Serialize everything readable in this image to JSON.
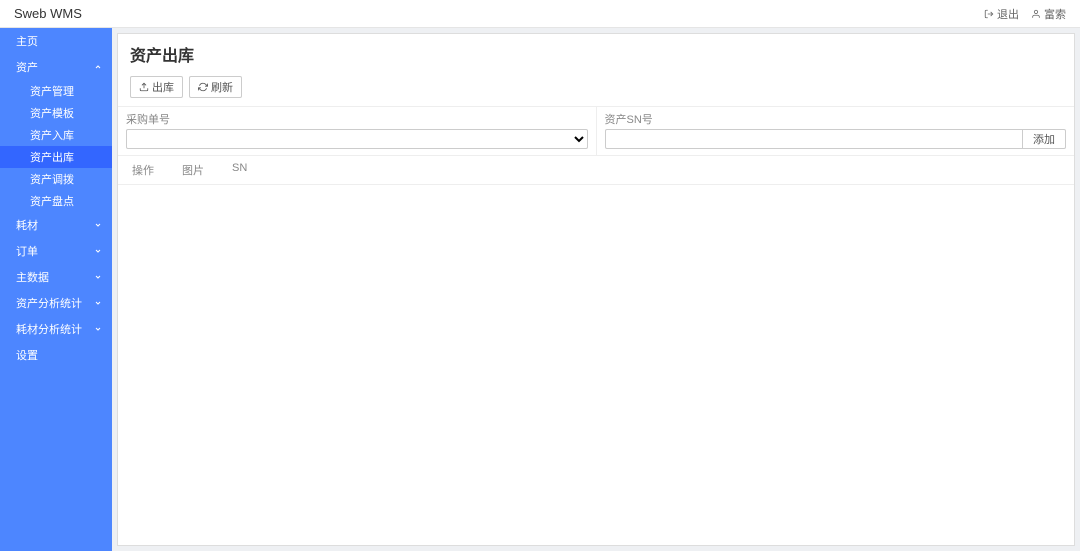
{
  "header": {
    "brand": "Sweb WMS",
    "logout": "退出",
    "user": "富索"
  },
  "sidebar": {
    "home": "主页",
    "asset": "资产",
    "asset_sub": {
      "manage": "资产管理",
      "template": "资产模板",
      "inbound": "资产入库",
      "outbound": "资产出库",
      "transfer": "资产调拨",
      "inventory": "资产盘点"
    },
    "consumable": "耗材",
    "order": "订单",
    "master": "主数据",
    "asset_stats": "资产分析统计",
    "consumable_stats": "耗材分析统计",
    "settings": "设置"
  },
  "page": {
    "title": "资产出库",
    "btn_outbound": "出库",
    "btn_refresh": "刷新",
    "filter_purchase": "采购单号",
    "filter_sn": "资产SN号",
    "btn_add": "添加",
    "table_cols": {
      "action": "操作",
      "image": "图片",
      "sn": "SN"
    }
  }
}
